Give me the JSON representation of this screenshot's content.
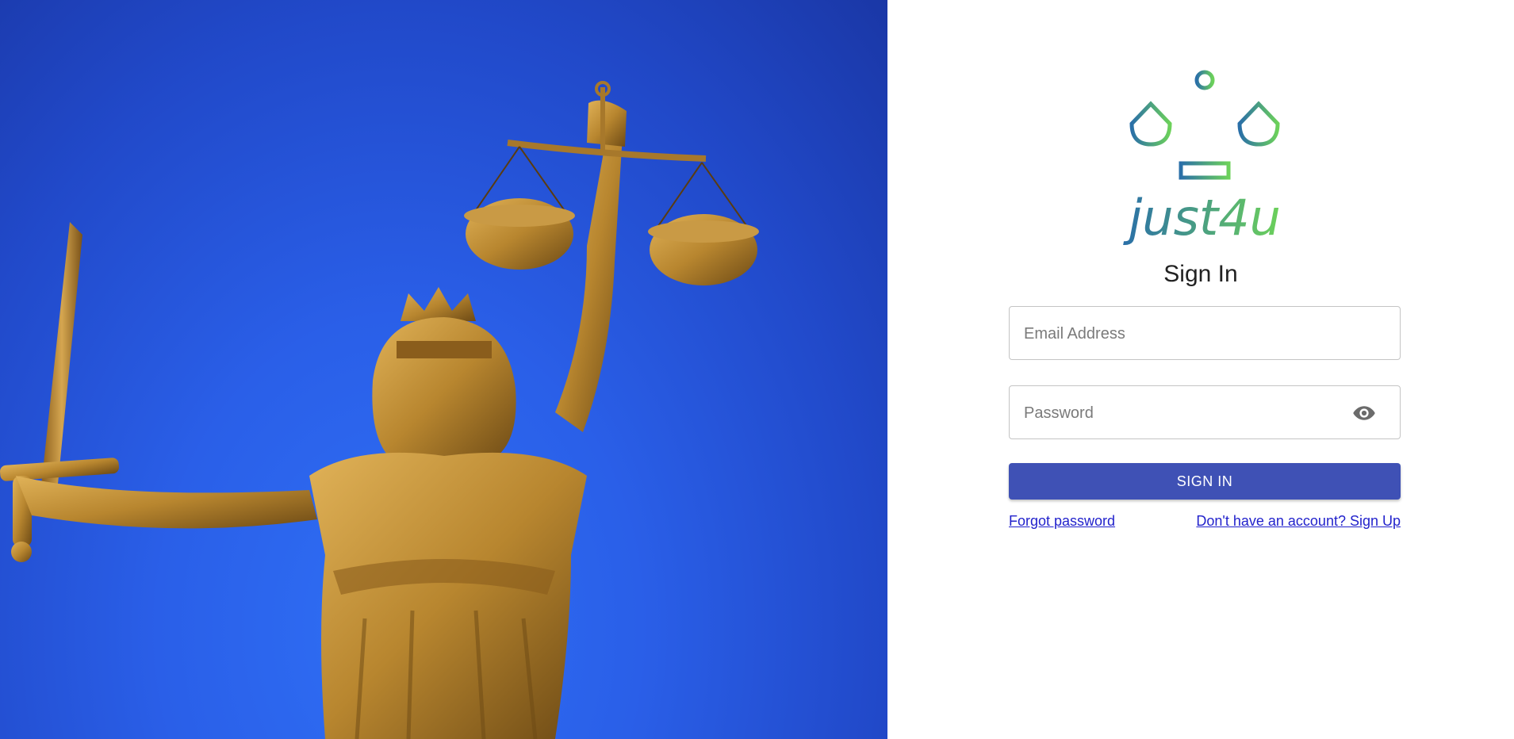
{
  "hero": {
    "image_alt": "Lady Justice statue holding scales and sword against a blue sky",
    "sky_color": "#2a5fe8",
    "statue_color": "#b8862f"
  },
  "brand": {
    "name": "just4u",
    "logo_icon": "scales-of-justice-icon",
    "gradient_start": "#2a6fa8",
    "gradient_end": "#6cd15a"
  },
  "form": {
    "title": "Sign In",
    "email_placeholder": "Email Address",
    "email_value": "",
    "password_placeholder": "Password",
    "password_value": "",
    "password_toggle_icon": "eye-icon",
    "submit_label": "SIGN IN",
    "forgot_link": "Forgot password",
    "signup_link": "Don't have an account? Sign Up"
  },
  "colors": {
    "primary": "#3f51b5",
    "link": "#2222cc",
    "border": "#c4c4c4"
  }
}
